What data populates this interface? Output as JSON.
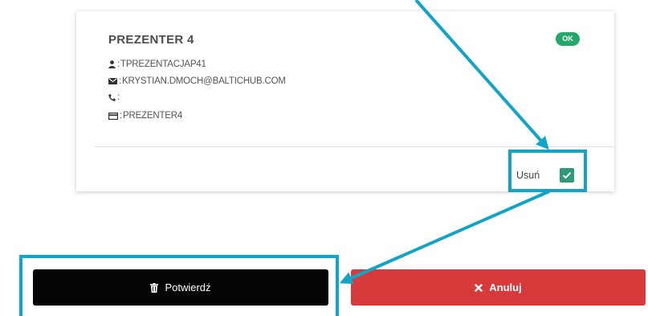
{
  "card": {
    "title": "PREZENTER 4",
    "status_badge": "OK",
    "login": "TPREZENTACJAP41",
    "email": "KRYSTIAN.DMOCH@BALTICHUB.COM",
    "phone": "",
    "card_id": "PREZENTER4",
    "remove_label": "Usuń",
    "remove_checked": true
  },
  "actions": {
    "confirm_label": "Potwierdź",
    "cancel_label": "Anuluj"
  },
  "colors": {
    "badge": "#23a86a",
    "checkbox": "#2e9a7b",
    "confirm_button": "#050505",
    "cancel_button": "#d63a3a",
    "annotation": "#12a4c6"
  },
  "icons": [
    "user-icon",
    "envelope-icon",
    "phone-icon",
    "credit-card-icon",
    "check-icon",
    "trash-icon",
    "times-icon",
    "arrow-icon"
  ]
}
